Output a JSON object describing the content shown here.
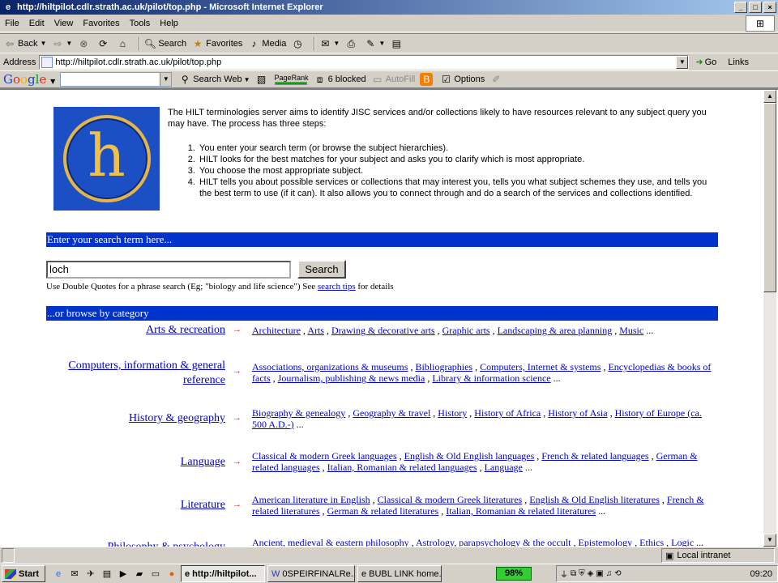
{
  "window": {
    "title": "http://hiltpilot.cdlr.strath.ac.uk/pilot/top.php - Microsoft Internet Explorer",
    "min": "_",
    "max": "□",
    "close": "×"
  },
  "menu": [
    "File",
    "Edit",
    "View",
    "Favorites",
    "Tools",
    "Help"
  ],
  "toolbar": {
    "back": "Back",
    "search": "Search",
    "favorites": "Favorites",
    "media": "Media"
  },
  "address": {
    "label": "Address",
    "url": "http://hiltpilot.cdlr.strath.ac.uk/pilot/top.php",
    "go": "Go",
    "links": "Links"
  },
  "googlebar": {
    "search_web": "Search Web",
    "pagerank": "PageRank",
    "blocked": "6 blocked",
    "autofill": "AutoFill",
    "options": "Options"
  },
  "page": {
    "intro": "The HILT terminologies server aims to identify JISC services and/or collections likely to have resources relevant to any subject query you may have. The process has three steps:",
    "steps": [
      "You enter your search term (or browse the subject hierarchies).",
      "HILT looks for the best matches for your subject and asks you to clarify which is most appropriate.",
      "You choose the most appropriate subject.",
      "HILT tells you about possible services or collections that may interest you, tells you what subject schemes they use, and tells you the best term to use (if it can). It also allows you to connect through and do a search of the services and collections identified."
    ],
    "search_header": "Enter your search term here...",
    "search_value": "loch",
    "search_button": "Search",
    "hint_prefix": "Use Double Quotes for a phrase search (Eg; \"biology and life science\") See ",
    "hint_link": "search tips",
    "hint_suffix": " for details",
    "browse_header": "...or browse by category",
    "categories": [
      {
        "name": "Arts & recreation",
        "subs": [
          "Architecture",
          "Arts",
          "Drawing & decorative arts",
          "Graphic arts",
          "Landscaping & area planning",
          "Music"
        ]
      },
      {
        "name": "Computers, information & general reference",
        "subs": [
          "Associations, organizations & museums",
          "Bibliographies",
          "Computers, Internet & systems",
          "Encyclopedias & books of facts",
          "Journalism, publishing & news media",
          "Library & information science"
        ]
      },
      {
        "name": "History & geography",
        "subs": [
          "Biography & genealogy",
          "Geography & travel",
          "History",
          "History of Africa",
          "History of Asia",
          "History of Europe (ca. 500 A.D.-)"
        ]
      },
      {
        "name": "Language",
        "subs": [
          "Classical & modern Greek languages",
          "English & Old English languages",
          "French & related languages",
          "German & related languages",
          "Italian, Romanian & related languages",
          "Language"
        ]
      },
      {
        "name": "Literature",
        "subs": [
          "American literature in English",
          "Classical & modern Greek literatures",
          "English & Old English literatures",
          "French & related literatures",
          "German & related literatures",
          "Italian, Romanian & related literatures"
        ]
      },
      {
        "name": "Philosophy & psychology",
        "subs": [
          "Ancient, medieval & eastern philosophy",
          "Astrology, parapsychology & the occult",
          "Epistemology",
          "Ethics",
          "Logic"
        ]
      }
    ],
    "ellipsis": "..."
  },
  "status": {
    "zone": "Local intranet"
  },
  "taskbar": {
    "start": "Start",
    "tasks": [
      "http://hiltpilot...",
      "0SPEIRFINALRe...",
      "BUBL LINK home..."
    ],
    "battery": "98%",
    "clock": "09:20"
  }
}
